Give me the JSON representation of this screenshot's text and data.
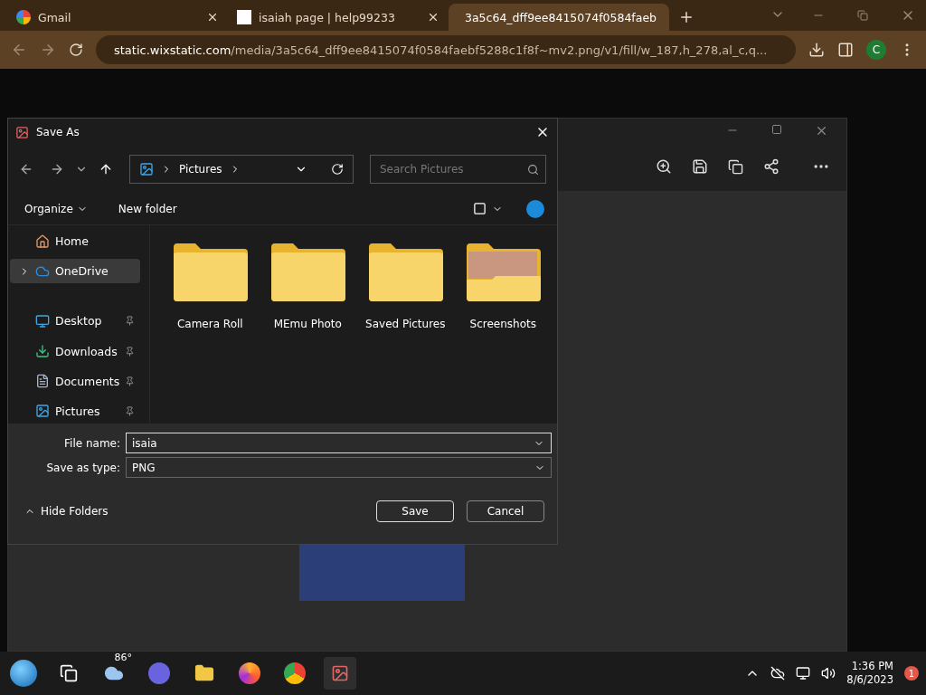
{
  "browser": {
    "tabs": [
      {
        "title": "Gmail",
        "selected": false
      },
      {
        "title": "isaiah page | help99233",
        "selected": false
      },
      {
        "title": "3a5c64_dff9ee8415074f0584faeb",
        "selected": true
      }
    ],
    "url_host": "static.wixstatic.com",
    "url_path": "/media/3a5c64_dff9ee8415074f0584faebf5288c1f8f~mv2.png/v1/fill/w_187,h_278,al_c,q...",
    "profile": "C"
  },
  "dialog": {
    "title": "Save As",
    "breadcrumb": "Pictures",
    "search": {
      "placeholder": "Search Pictures"
    },
    "commands": [
      "Organize",
      "New folder"
    ],
    "nav": [
      {
        "label": "Home",
        "pinned": false,
        "selected": false,
        "expandable": false
      },
      {
        "label": "OneDrive",
        "pinned": false,
        "selected": true,
        "expandable": true
      },
      {
        "label": "Desktop",
        "pinned": true,
        "selected": false,
        "expandable": false
      },
      {
        "label": "Downloads",
        "pinned": true,
        "selected": false,
        "expandable": false
      },
      {
        "label": "Documents",
        "pinned": true,
        "selected": false,
        "expandable": false
      },
      {
        "label": "Pictures",
        "pinned": true,
        "selected": false,
        "expandable": false
      }
    ],
    "folders": [
      {
        "name": "Camera Roll",
        "kind": "plain"
      },
      {
        "name": "MEmu Photo",
        "kind": "plain"
      },
      {
        "name": "Saved Pictures",
        "kind": "plain"
      },
      {
        "name": "Screenshots",
        "kind": "photo"
      }
    ],
    "file_name": {
      "label": "File name:",
      "value": "isaia"
    },
    "save_type": {
      "label": "Save as type:",
      "value": "PNG"
    },
    "hide_folders": "Hide Folders",
    "buttons": [
      "Save",
      "Cancel"
    ]
  },
  "taskbar": {
    "weather": "86°",
    "time": "1:36 PM",
    "date": "8/6/2023",
    "notifications": "1"
  }
}
